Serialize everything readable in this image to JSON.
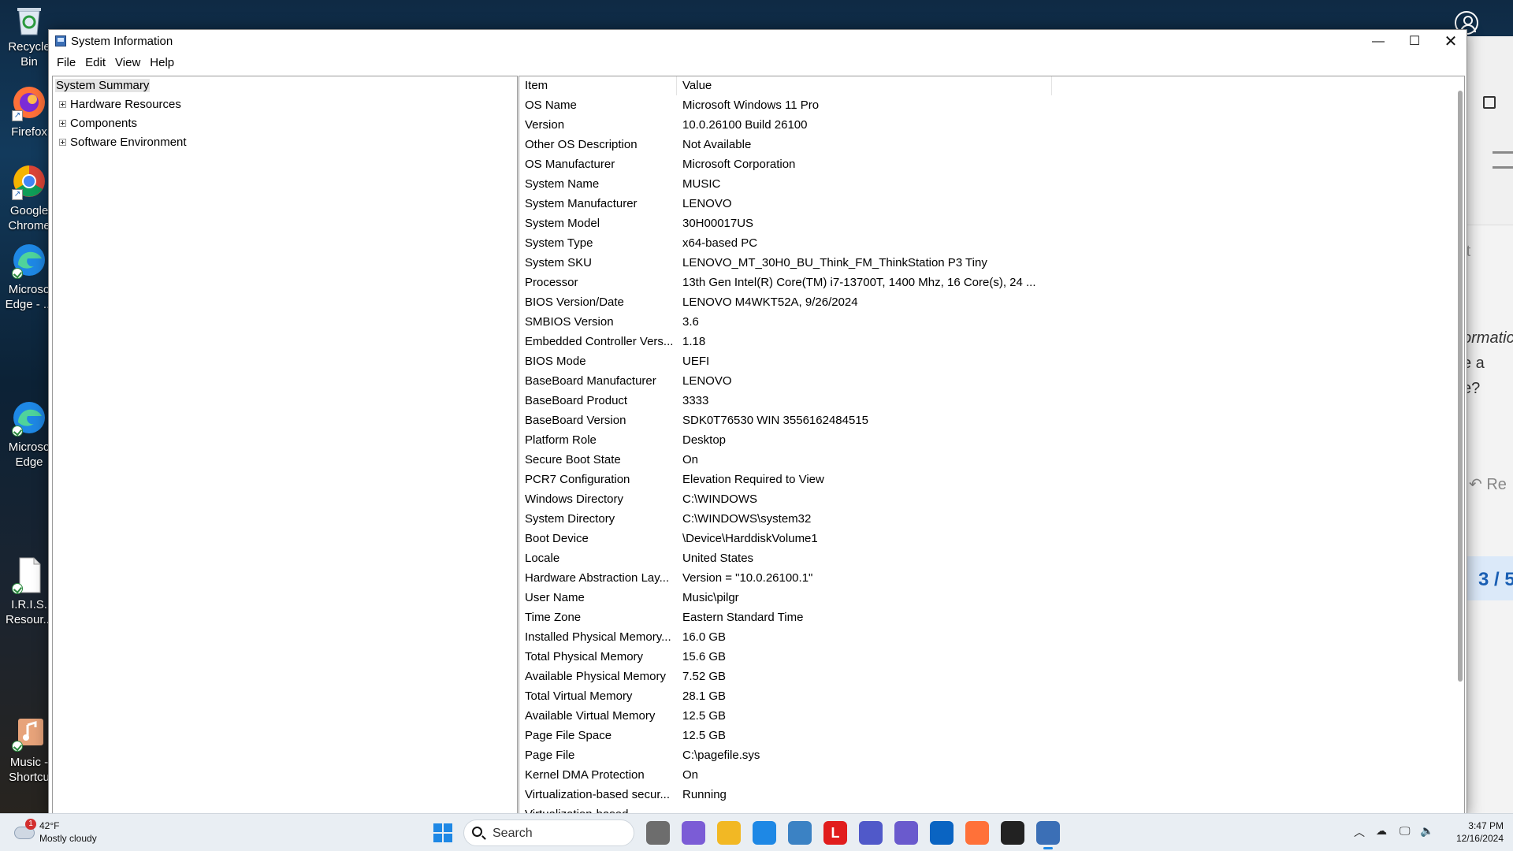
{
  "desktop": {
    "icons": [
      {
        "label1": "Recycle",
        "label2": "Bin",
        "icon": "recycle-bin-icon"
      },
      {
        "label1": "Firefox",
        "label2": "",
        "icon": "firefox-icon"
      },
      {
        "label1": "Google",
        "label2": "Chrome",
        "icon": "chrome-icon"
      },
      {
        "label1": "Microso",
        "label2": "Edge - ...",
        "icon": "edge-icon"
      },
      {
        "label1": "Microso",
        "label2": "Edge",
        "icon": "edge-icon"
      },
      {
        "label1": "I.R.I.S.",
        "label2": "Resour...",
        "icon": "document-icon"
      },
      {
        "label1": "Music -",
        "label2": "Shortcu",
        "icon": "music-icon"
      }
    ]
  },
  "background_app": {
    "text1": "ormatic",
    "text2": "e a",
    "text3": "e?",
    "reply": "Re",
    "page": "3 / 5",
    "partial": "rt"
  },
  "window": {
    "title": "System Information",
    "controls": {
      "minimize": "—",
      "maximize": "☐",
      "close": "✕"
    },
    "menu": [
      "File",
      "Edit",
      "View",
      "Help"
    ],
    "tree": {
      "root": "System Summary",
      "children": [
        "Hardware Resources",
        "Components",
        "Software Environment"
      ]
    },
    "table": {
      "headers": [
        "Item",
        "Value"
      ],
      "rows": [
        [
          "OS Name",
          "Microsoft Windows 11 Pro"
        ],
        [
          "Version",
          "10.0.26100 Build 26100"
        ],
        [
          "Other OS Description",
          "Not Available"
        ],
        [
          "OS Manufacturer",
          "Microsoft Corporation"
        ],
        [
          "System Name",
          "MUSIC"
        ],
        [
          "System Manufacturer",
          "LENOVO"
        ],
        [
          "System Model",
          "30H00017US"
        ],
        [
          "System Type",
          "x64-based PC"
        ],
        [
          "System SKU",
          "LENOVO_MT_30H0_BU_Think_FM_ThinkStation P3 Tiny"
        ],
        [
          "Processor",
          "13th Gen Intel(R) Core(TM) i7-13700T, 1400 Mhz, 16 Core(s), 24 ..."
        ],
        [
          "BIOS Version/Date",
          "LENOVO M4WKT52A, 9/26/2024"
        ],
        [
          "SMBIOS Version",
          "3.6"
        ],
        [
          "Embedded Controller Vers...",
          "1.18"
        ],
        [
          "BIOS Mode",
          "UEFI"
        ],
        [
          "BaseBoard Manufacturer",
          "LENOVO"
        ],
        [
          "BaseBoard Product",
          "3333"
        ],
        [
          "BaseBoard Version",
          "SDK0T76530 WIN 3556162484515"
        ],
        [
          "Platform Role",
          "Desktop"
        ],
        [
          "Secure Boot State",
          "On"
        ],
        [
          "PCR7 Configuration",
          "Elevation Required to View"
        ],
        [
          "Windows Directory",
          "C:\\WINDOWS"
        ],
        [
          "System Directory",
          "C:\\WINDOWS\\system32"
        ],
        [
          "Boot Device",
          "\\Device\\HarddiskVolume1"
        ],
        [
          "Locale",
          "United States"
        ],
        [
          "Hardware Abstraction Lay...",
          "Version = \"10.0.26100.1\""
        ],
        [
          "User Name",
          "Music\\pilgr"
        ],
        [
          "Time Zone",
          "Eastern Standard Time"
        ],
        [
          "Installed Physical Memory...",
          "16.0 GB"
        ],
        [
          "Total Physical Memory",
          "15.6 GB"
        ],
        [
          "Available Physical Memory",
          "7.52 GB"
        ],
        [
          "Total Virtual Memory",
          "28.1 GB"
        ],
        [
          "Available Virtual Memory",
          "12.5 GB"
        ],
        [
          "Page File Space",
          "12.5 GB"
        ],
        [
          "Page File",
          "C:\\pagefile.sys"
        ],
        [
          "Kernel DMA Protection",
          "On"
        ],
        [
          "Virtualization-based secur...",
          "Running"
        ],
        [
          "Virtualization-based...",
          ""
        ]
      ]
    }
  },
  "taskbar": {
    "weather": {
      "temp": "42°F",
      "desc": "Mostly cloudy",
      "badge": "1"
    },
    "search_placeholder": "Search",
    "apps": [
      {
        "icon": "task-view-icon",
        "color": "#6d6d6d"
      },
      {
        "icon": "copilot-icon",
        "color": "#7b5cd6"
      },
      {
        "icon": "file-explorer-icon",
        "color": "#f2b824"
      },
      {
        "icon": "edge-icon",
        "color": "#1e88e5"
      },
      {
        "icon": "microsoft-store-icon",
        "color": "#3b82c4"
      },
      {
        "icon": "lenovo-vantage-icon",
        "color": "#e11d1d",
        "text": "L"
      },
      {
        "icon": "teams-icon",
        "color": "#5059c9"
      },
      {
        "icon": "media-player-icon",
        "color": "#6a5acd"
      },
      {
        "icon": "outlook-icon",
        "color": "#0a64c2"
      },
      {
        "icon": "firefox-icon",
        "color": "#ff7139"
      },
      {
        "icon": "linn-app-icon",
        "color": "#222222"
      },
      {
        "icon": "system-information-icon",
        "color": "#3b6fb6",
        "active": true
      }
    ],
    "clock": {
      "time": "3:47 PM",
      "date": "12/16/2024"
    }
  }
}
